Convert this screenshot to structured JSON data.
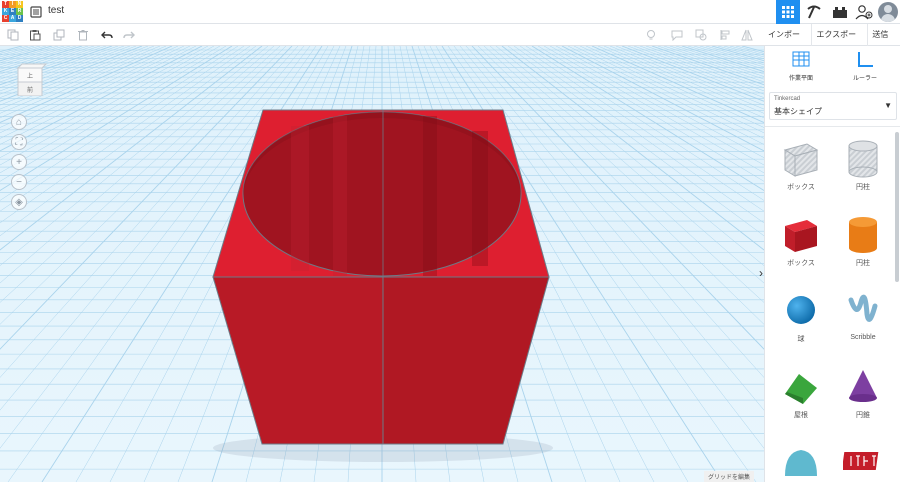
{
  "app": {
    "logo_letters": [
      "T",
      "I",
      "N",
      "K",
      "E",
      "R",
      "C",
      "A",
      "D"
    ],
    "logo_colors": [
      "#e8412f",
      "#f39c25",
      "#f6c51c",
      "#3aa6dd",
      "#2e7fc1",
      "#6cc24a",
      "#e8412f",
      "#3aa6dd",
      "#2e7fc1"
    ],
    "doc_title": "test",
    "accent": "#1f8ff0"
  },
  "toolbar": {
    "icons": [
      "copy-icon",
      "paste-icon",
      "duplicate-icon",
      "delete-icon",
      "undo-icon",
      "redo-icon"
    ],
    "right_icons": [
      "note-icon",
      "comment-icon",
      "group-icon",
      "align-icon",
      "mirror-icon"
    ]
  },
  "export_bar": {
    "import_label": "インポート",
    "export_label": "エクスポート",
    "send_label": "送信先"
  },
  "workplane": {
    "viewcube_top": "上",
    "viewcube_front": "前",
    "grid_edit_label": "グリッドを編集",
    "shape_color": "#c41d2a"
  },
  "panel": {
    "workplane_tool_label": "作業平面",
    "ruler_tool_label": "ルーラー",
    "library_sub": "Tinkercad",
    "library_name": "基本シェイプ",
    "shapes": [
      {
        "label": "ボックス",
        "icon": "striped-box-icon"
      },
      {
        "label": "円柱",
        "icon": "striped-cylinder-icon"
      },
      {
        "label": "ボックス",
        "icon": "red-box-icon"
      },
      {
        "label": "円柱",
        "icon": "orange-cylinder-icon"
      },
      {
        "label": "球",
        "icon": "blue-sphere-icon"
      },
      {
        "label": "Scribble",
        "icon": "scribble-icon"
      },
      {
        "label": "屋根",
        "icon": "green-roof-icon"
      },
      {
        "label": "円錐",
        "icon": "purple-cone-icon"
      },
      {
        "label": "",
        "icon": "teal-round-roof-icon"
      },
      {
        "label": "",
        "icon": "red-text-icon"
      }
    ]
  }
}
